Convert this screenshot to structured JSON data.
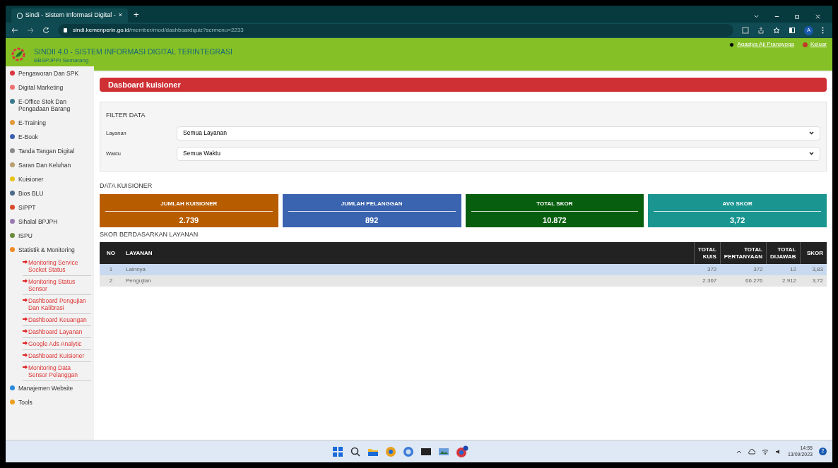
{
  "browser": {
    "tab_title": "Sindi - Sistem Informasi Digital -",
    "tab_close": "×",
    "new_tab": "+",
    "url_host": "sindi.kemenperin.go.id",
    "url_path": "/member/mod/dashboardquiz?scrmenu=2233",
    "profile": "A"
  },
  "header": {
    "title": "SINDII 4.0 - SISTEM INFORMASI DIGITAL TERINTEGRASI",
    "subtitle": "BBSPJPPI Semarang",
    "user": "Agastya Aji Pranayoga",
    "logout": "Keluar"
  },
  "sidebar": {
    "items": [
      {
        "label": "Pengaworan Dan SPK",
        "color": "#d9363e"
      },
      {
        "label": "Digital Marketing",
        "color": "#f07070"
      },
      {
        "label": "E-Office Stok Dan Pengadaan Barang",
        "color": "#3a7a8c"
      },
      {
        "label": "E-Training",
        "color": "#e39a3b"
      },
      {
        "label": "E-Book",
        "color": "#3b5fb0"
      },
      {
        "label": "Tanda Tangan Digital",
        "color": "#8a8a8a"
      },
      {
        "label": "Saran Dan Keluhan",
        "color": "#b8a070"
      },
      {
        "label": "Kuisioner",
        "color": "#e8c21a"
      },
      {
        "label": "Bios BLU",
        "color": "#4a6a8a"
      },
      {
        "label": "SIPPT",
        "color": "#d94a2a"
      },
      {
        "label": "Sihalal BPJPH",
        "color": "#9a7ab0"
      },
      {
        "label": "ISPU",
        "color": "#6a8a3a"
      },
      {
        "label": "Statistik & Monitoring",
        "color": "#f08a24",
        "children": [
          {
            "label": "Monitoring Service Socket Status"
          },
          {
            "label": "Monitoring Status Sensor"
          },
          {
            "label": "Dashboard Pengujian Dan Kalibrasi"
          },
          {
            "label": "Dashboard Keuangan"
          },
          {
            "label": "Dashboard Layanan"
          },
          {
            "label": "Google Ads Analytic"
          },
          {
            "label": "Dashboard Kuisioner"
          },
          {
            "label": "Monitoring Data Sensor Pelanggan"
          }
        ]
      },
      {
        "label": "Manajemen Website",
        "color": "#2a8ad9"
      },
      {
        "label": "Tools",
        "color": "#f0a020"
      }
    ]
  },
  "page_title": "Dasboard kuisioner",
  "filter": {
    "heading": "FILTER DATA",
    "fields": [
      {
        "label": "Layanan",
        "value": "Semua Layanan"
      },
      {
        "label": "Waktu",
        "value": "Semua Waktu"
      }
    ]
  },
  "data_heading": "DATA KUISIONER",
  "stats": [
    {
      "label": "JUMLAH KUISIONER",
      "value": "2.739",
      "color": "#b85c00"
    },
    {
      "label": "JUMLAH PELANGGAN",
      "value": "892",
      "color": "#3a63b0"
    },
    {
      "label": "TOTAL SKOR",
      "value": "10.872",
      "color": "#075e0e"
    },
    {
      "label": "AVG SKOR",
      "value": "3,72",
      "color": "#1a9590"
    }
  ],
  "table_heading": "SKOR BERDASARKAN LAYANAN",
  "table": {
    "columns": [
      "NO",
      "LAYANAN",
      "TOTAL KUIS",
      "TOTAL PERTANYAAN",
      "TOTAL DIJAWAB",
      "SKOR"
    ],
    "rows": [
      {
        "cells": [
          "1",
          "Lainnya",
          "372",
          "372",
          "12",
          "3,83"
        ],
        "selected": true
      },
      {
        "cells": [
          "2",
          "Pengujian",
          "2.367",
          "66.276",
          "2.912",
          "3,72"
        ],
        "selected": false
      }
    ]
  },
  "taskbar": {
    "time": "14:55",
    "date": "13/09/2023",
    "notifications": "2"
  }
}
